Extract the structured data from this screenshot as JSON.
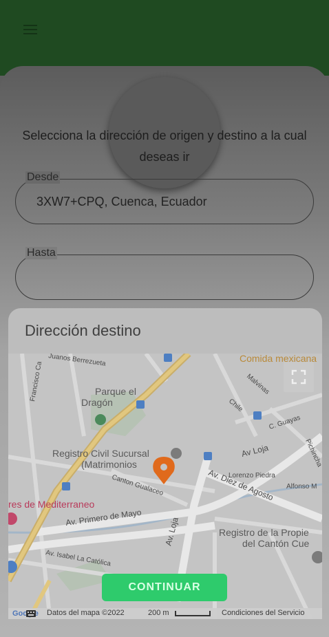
{
  "header": {
    "menu_icon": "hamburger-menu-icon"
  },
  "profile": {
    "avatar_icon": "avatar-placeholder"
  },
  "form": {
    "instruction": "Selecciona la dirección de origen y destino a la cual deseas ir",
    "origin": {
      "label": "Desde",
      "value": "3XW7+CPQ, Cuenca, Ecuador"
    },
    "destination": {
      "label": "Hasta",
      "value": ""
    }
  },
  "sheet": {
    "title": "Dirección destino",
    "map": {
      "labels": {
        "comida": "Comida mexicana",
        "parque": "Parque el",
        "parque2": "Dragón",
        "registro": "Registro Civil Sucursal",
        "registro2": "(Matrimonios",
        "mediterraneo": "res de Mediterraneo",
        "av_loja": "Av Loja",
        "av_loja2": "Av. Loja",
        "diez": "Av. Diez de Agosto",
        "primero": "Av. Primero de Mayo",
        "isabel": "Av. Isabel La Católica",
        "gualaceo": "Canton Gualaceo",
        "lorenzo": "Lorenzo Piedra",
        "alfonso": "Alfonso M",
        "guayas": "C. Guayas",
        "chile": "Chile",
        "malvinas": "Malvinas",
        "pichincha": "Pichincha",
        "francisco": "Francisco Ca",
        "berrezueta": "Juanos Berrezueta",
        "propiedad": "Registro de la Propie",
        "canton": "del Cantón Cue"
      },
      "footer": {
        "data": "Datos del mapa ©2022",
        "scale": "200 m",
        "terms": "Condiciones del Servicio",
        "logo": "Google"
      }
    },
    "continue_label": "CONTINUAR"
  },
  "colors": {
    "button": "#2ecb6c",
    "header": "#1f4a21",
    "pin": "#e06a1c"
  }
}
